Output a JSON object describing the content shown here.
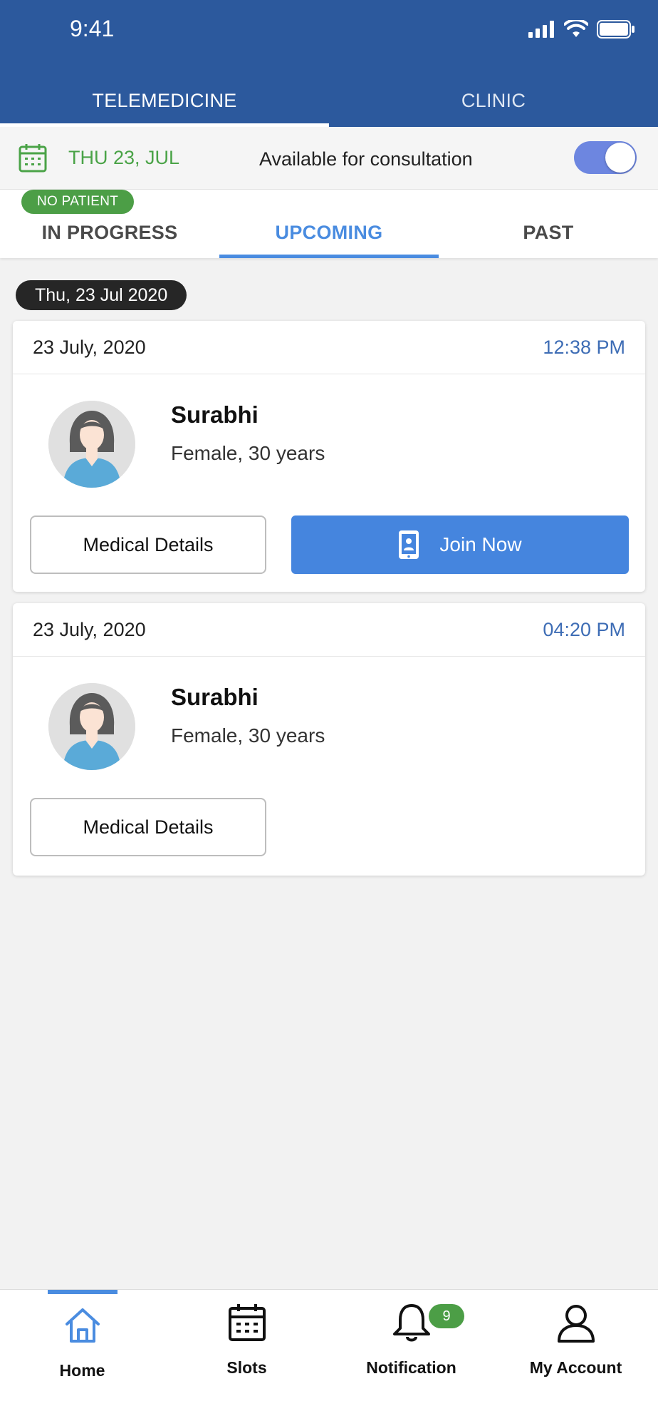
{
  "status_bar": {
    "time": "9:41"
  },
  "top_tabs": [
    {
      "label": "TELEMEDICINE",
      "active": true
    },
    {
      "label": "CLINIC",
      "active": false
    }
  ],
  "availability": {
    "date": "THU 23, JUL",
    "label": "Available for consultation",
    "toggle_on": true
  },
  "sub_tabs": [
    {
      "label": "IN PROGRESS",
      "badge": "NO PATIENT"
    },
    {
      "label": "UPCOMING",
      "active": true
    },
    {
      "label": "PAST"
    }
  ],
  "date_group": "Thu, 23 Jul 2020",
  "appointments": [
    {
      "date": "23 July, 2020",
      "time": "12:38 PM",
      "name": "Surabhi",
      "meta": "Female, 30 years",
      "details_label": "Medical Details",
      "join_label": "Join Now"
    },
    {
      "date": "23 July, 2020",
      "time": "04:20 PM",
      "name": "Surabhi",
      "meta": "Female, 30 years",
      "details_label": "Medical Details"
    }
  ],
  "bottom_nav": [
    {
      "label": "Home",
      "icon": "home-icon",
      "active": true
    },
    {
      "label": "Slots",
      "icon": "calendar-icon"
    },
    {
      "label": "Notification",
      "icon": "bell-icon",
      "badge": "9"
    },
    {
      "label": "My Account",
      "icon": "user-icon"
    }
  ],
  "colors": {
    "header": "#2c599d",
    "accent": "#4a8ce0",
    "green": "#4c9e46",
    "primary_button": "#4585de"
  }
}
